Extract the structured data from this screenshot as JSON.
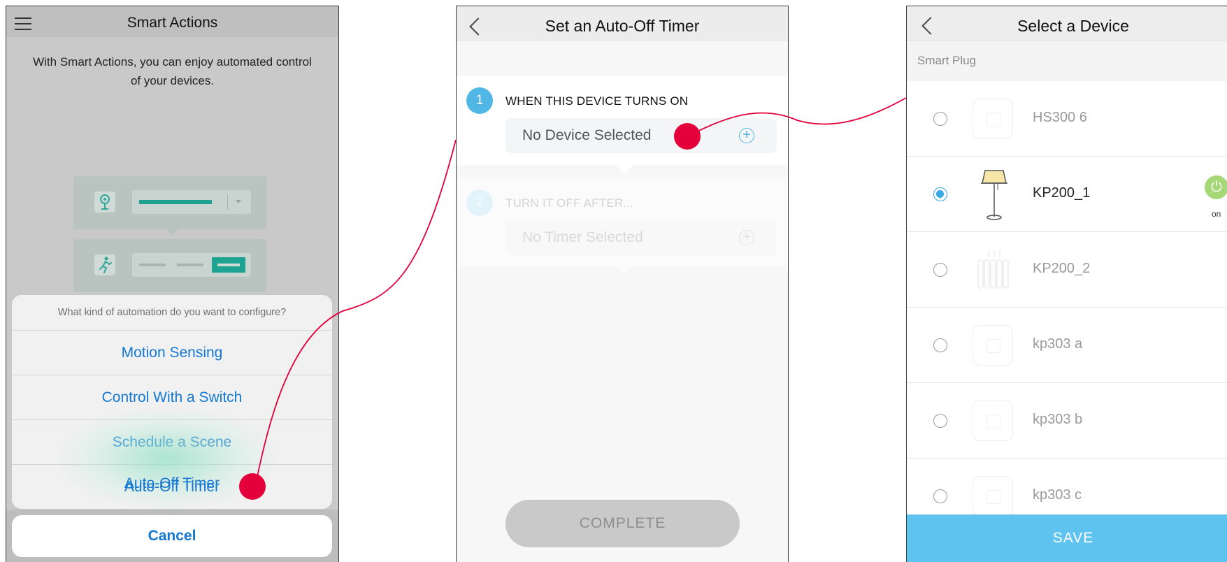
{
  "screen1": {
    "title": "Smart Actions",
    "description": "With Smart Actions, you can enjoy automated control of your devices.",
    "sheet": {
      "question": "What kind of automation do you want to configure?",
      "options": [
        "Motion Sensing",
        "Control With a Switch",
        "Schedule a Scene",
        "Auto-Off Timer"
      ],
      "cancel": "Cancel"
    },
    "icons": [
      "menu-icon",
      "camera-icon",
      "motion-person-icon"
    ]
  },
  "screen2": {
    "title": "Set an Auto-Off Timer",
    "step1": {
      "number": "1",
      "label": "WHEN THIS DEVICE TURNS ON",
      "value": "No Device Selected"
    },
    "step2": {
      "number": "2",
      "label": "TURN IT OFF AFTER...",
      "value": "No Timer Selected"
    },
    "complete": "COMPLETE",
    "icons": [
      "back-icon",
      "plus-icon"
    ]
  },
  "screen3": {
    "title": "Select a Device",
    "category": "Smart Plug",
    "devices": [
      {
        "name": "HS300 6",
        "selected": false,
        "icon": "plug-icon"
      },
      {
        "name": "KP200_1",
        "selected": true,
        "icon": "lamp-icon",
        "status": "on"
      },
      {
        "name": "KP200_2",
        "selected": false,
        "icon": "heater-icon"
      },
      {
        "name": "kp303 a",
        "selected": false,
        "icon": "plug-icon"
      },
      {
        "name": "kp303 b",
        "selected": false,
        "icon": "plug-icon"
      },
      {
        "name": "kp303 c",
        "selected": false,
        "icon": "plug-icon"
      }
    ],
    "save": "SAVE"
  },
  "colors": {
    "accent_blue": "#1478d2",
    "step_blue": "#4fb6e6",
    "callout_red": "#e4003a",
    "save_blue": "#5ec3ee",
    "power_green": "#a6d878"
  }
}
